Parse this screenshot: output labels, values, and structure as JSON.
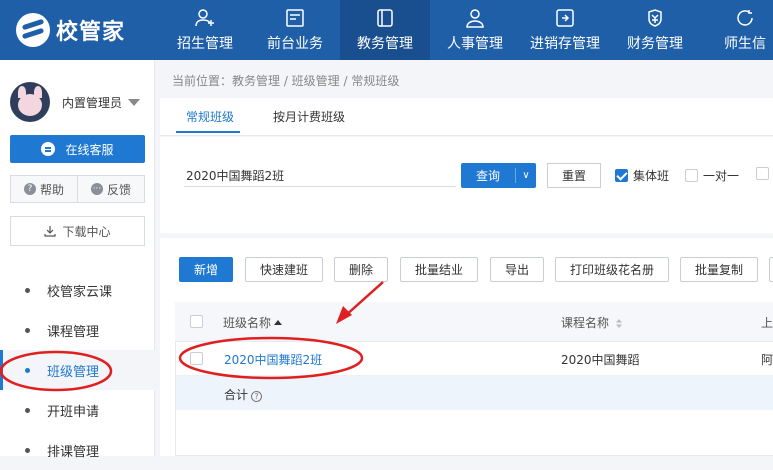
{
  "app": {
    "logo_text": "校管家",
    "brand_color": "#1f5fa8",
    "accent_color": "#1f78d1",
    "annotation_color": "#e02020"
  },
  "nav": [
    {
      "label": "招生管理",
      "icon": "user-plus-icon"
    },
    {
      "label": "前台业务",
      "icon": "monitor-icon"
    },
    {
      "label": "教务管理",
      "icon": "book-icon",
      "active": true
    },
    {
      "label": "人事管理",
      "icon": "person-icon"
    },
    {
      "label": "进销存管理",
      "icon": "inventory-icon"
    },
    {
      "label": "财务管理",
      "icon": "money-icon"
    },
    {
      "label": "师生信",
      "icon": "chat-icon"
    }
  ],
  "sidebar": {
    "username": "内置管理员",
    "service_label": "在线客服",
    "help_label": "帮助",
    "feedback_label": "反馈",
    "download_label": "下载中心",
    "menu": [
      {
        "label": "校管家云课"
      },
      {
        "label": "课程管理"
      },
      {
        "label": "班级管理",
        "active": true
      },
      {
        "label": "开班申请"
      },
      {
        "label": "排课管理"
      }
    ]
  },
  "breadcrumb": "当前位置：教务管理 / 班级管理 / 常规班级",
  "tabs": [
    {
      "label": "常规班级",
      "active": true
    },
    {
      "label": "按月计费班级"
    }
  ],
  "search": {
    "value": "2020中国舞蹈2班",
    "query_label": "查询",
    "reset_label": "重置",
    "filters": [
      {
        "label": "集体班",
        "checked": true
      },
      {
        "label": "一对一",
        "checked": false
      }
    ]
  },
  "actions": {
    "add": "新增",
    "quick_create": "快速建班",
    "delete": "删除",
    "batch_close": "批量结业",
    "export": "导出",
    "print_roster": "打印班级花名册",
    "batch_copy": "批量复制"
  },
  "table": {
    "columns": [
      "班级名称",
      "课程名称",
      "上"
    ],
    "rows": [
      {
        "class_name": "2020中国舞蹈2班",
        "course_name": "2020中国舞蹈",
        "extra": "阿"
      }
    ],
    "summary_label": "合计"
  }
}
